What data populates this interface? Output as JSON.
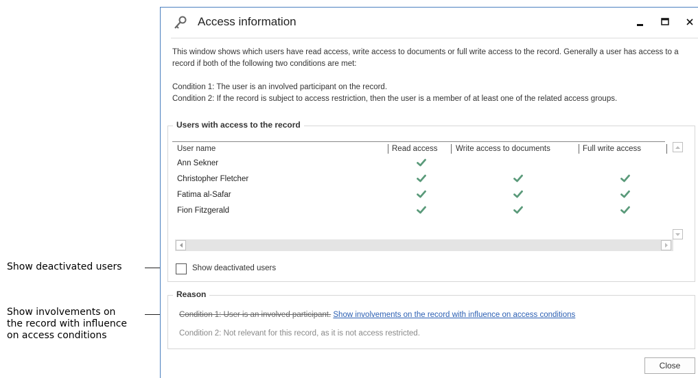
{
  "callouts": {
    "deactivated": "Show deactivated users",
    "involvements_line1": "Show involvements on",
    "involvements_line2": "the record with influence",
    "involvements_line3": "on access conditions"
  },
  "window": {
    "title": "Access information",
    "title_icon": "key-icon",
    "intro_1": "This window shows which users have read access, write access to documents or full write access to the record. Generally a user has access to a record if both of the following two conditions are met:",
    "condition_1": "Condition 1: The user is an involved participant on the record.",
    "condition_2": "Condition 2: If the record is subject to access restriction, then the user is a member of at least one of the related access groups."
  },
  "users_section": {
    "legend": "Users with access to the record",
    "columns": [
      "User name",
      "Read access",
      "Write access to documents",
      "Full write access"
    ],
    "rows": [
      {
        "name": "Ann Sekner",
        "read": true,
        "write_docs": false,
        "full_write": false
      },
      {
        "name": "Christopher Fletcher",
        "read": true,
        "write_docs": true,
        "full_write": true
      },
      {
        "name": "Fatima al-Safar",
        "read": true,
        "write_docs": true,
        "full_write": true
      },
      {
        "name": "Fion Fitzgerald",
        "read": true,
        "write_docs": true,
        "full_write": true
      }
    ],
    "show_deactivated_label": "Show deactivated users",
    "show_deactivated_checked": false
  },
  "reason_section": {
    "legend": "Reason",
    "condition_1_text": "Condition 1: User is an involved participant.",
    "condition_1_link": "Show involvements on the record with influence on access conditions",
    "condition_2_text": "Condition 2: Not relevant for this record, as it is not access restricted."
  },
  "footer": {
    "close_label": "Close"
  },
  "colors": {
    "check": "#5a9a7a",
    "link": "#2b5fb3",
    "window_border": "#4a7fbf"
  }
}
